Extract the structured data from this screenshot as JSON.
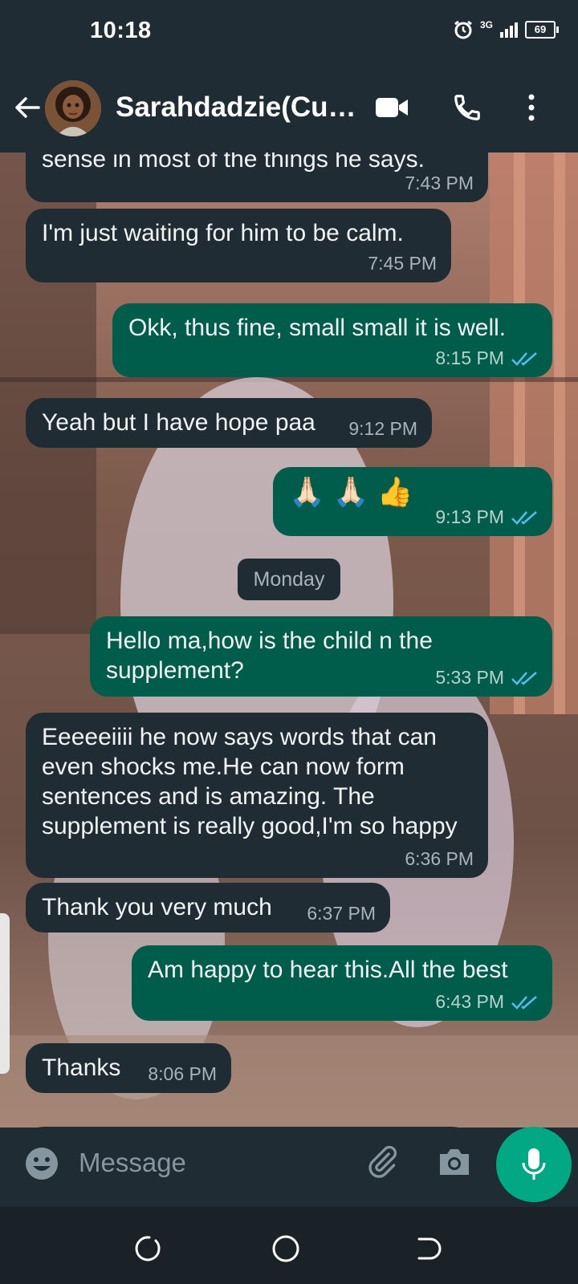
{
  "status_bar": {
    "time": "10:18",
    "battery": "69",
    "network": "3G"
  },
  "header": {
    "contact_name": "Sarahdadzie(Customer)"
  },
  "messages": [
    {
      "dir": "in",
      "text": "sense in most of the things he says.",
      "time": "7:43 PM"
    },
    {
      "dir": "in",
      "text": "I'm just waiting for him to be calm.",
      "time": "7:45 PM"
    },
    {
      "dir": "out",
      "text": "Okk, thus fine, small small it is well.",
      "time": "8:15 PM"
    },
    {
      "dir": "in",
      "text": "Yeah but I have hope paa",
      "time": "9:12 PM"
    },
    {
      "dir": "out",
      "text": "🙏🏻 🙏🏻 👍",
      "time": "9:13 PM"
    },
    {
      "dir": "out",
      "text": "Hello ma,how is the child n the supplement?",
      "time": "5:33 PM"
    },
    {
      "dir": "in",
      "text": "Eeeeeiiii he now says words that can even shocks me.He can now form sentences and is amazing. The supplement is really good,I'm so happy",
      "time": "6:36 PM"
    },
    {
      "dir": "in",
      "text": "Thank you very much",
      "time": "6:37 PM"
    },
    {
      "dir": "out",
      "text": "Am happy to hear this.All the best",
      "time": "6:43 PM"
    },
    {
      "dir": "in",
      "text": "Thanks",
      "time": "8:06 PM"
    }
  ],
  "date_separator": "Monday",
  "input": {
    "placeholder": "Message"
  },
  "colors": {
    "incoming": "#202c33",
    "outgoing": "#005c4b",
    "accent": "#00a884",
    "read_ticks": "#53bdeb"
  }
}
